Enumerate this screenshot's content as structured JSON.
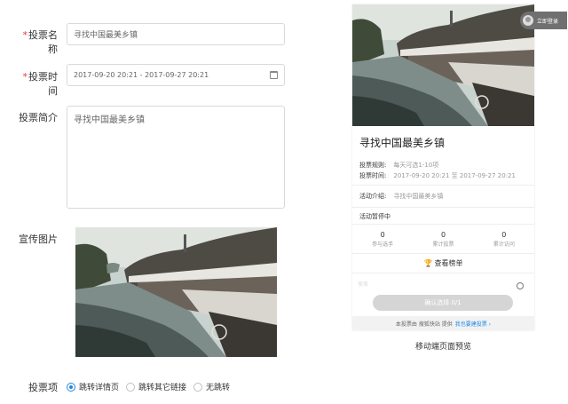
{
  "form": {
    "name_label": "投票名称",
    "name_value": "寻找中国最美乡镇",
    "time_label": "投票时间",
    "time_value": "2017-09-20 20:21 - 2017-09-27 20:21",
    "intro_label": "投票简介",
    "intro_value": "寻找中国最美乡镇",
    "image_label": "宣传图片",
    "items_label": "投票项",
    "required_mark": "*",
    "radio": [
      {
        "label": "跳转详情页",
        "selected": true
      },
      {
        "label": "跳转其它链接",
        "selected": false
      },
      {
        "label": "无跳转",
        "selected": false
      }
    ]
  },
  "preview": {
    "login_label": "立即登录",
    "title": "寻找中国最美乡镇",
    "rule_label": "投票规则:",
    "rule_value": "每天可选1-10项",
    "time_label": "投票时间:",
    "time_value": "2017-09-20 20:21 至 2017-09-27 20:21",
    "intro_label": "活动介绍:",
    "intro_value": "寻找中国最美乡镇",
    "status": "活动暂停中",
    "stats": [
      {
        "value": "0",
        "label": "参与选手"
      },
      {
        "value": "0",
        "label": "累计投票"
      },
      {
        "value": "0",
        "label": "累计访问"
      }
    ],
    "rank_label": "查看榜单",
    "search_placeholder": "搜索",
    "confirm_label": "确认选择 0/1",
    "footer_text": "本投票由 搜狐快站 提供",
    "footer_link": "我也要建投票 ›",
    "caption": "移动端页面预览"
  },
  "colors": {
    "accent": "#1e88e5",
    "required": "#e4393c"
  },
  "icons": {
    "calendar": "calendar-icon",
    "trophy": "trophy-icon",
    "search": "search-icon",
    "radio": "radio-icon"
  }
}
